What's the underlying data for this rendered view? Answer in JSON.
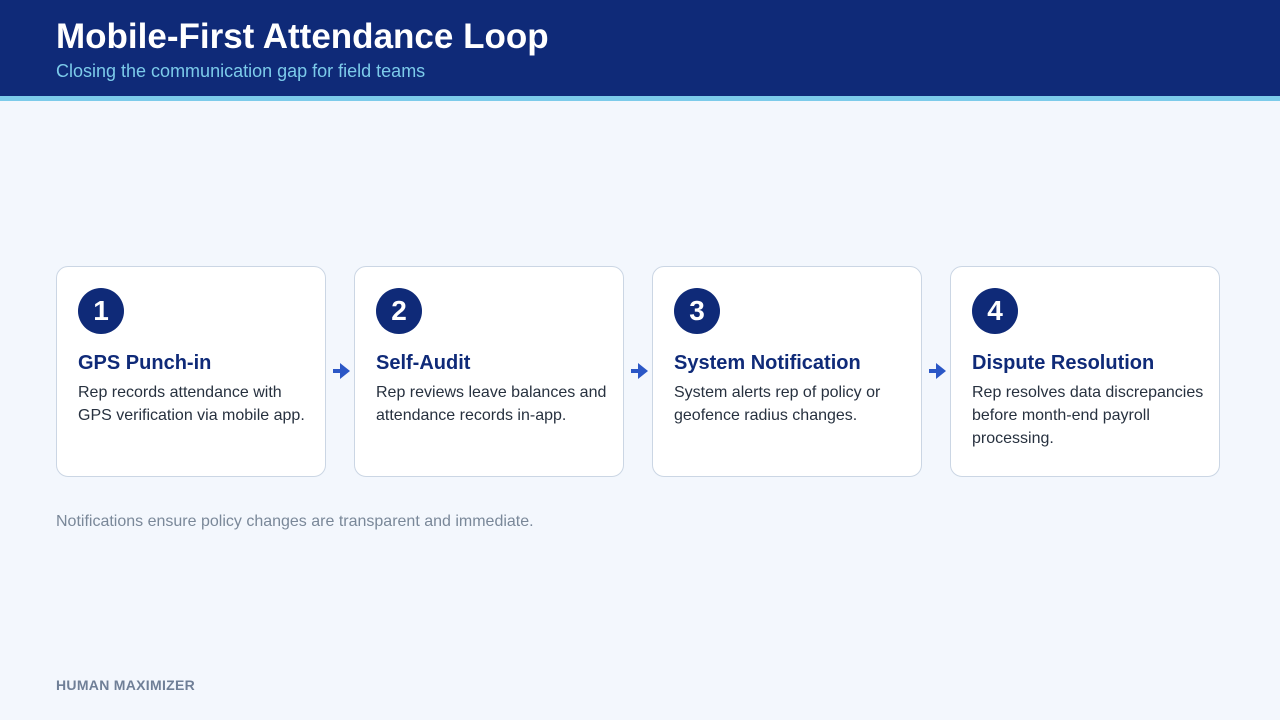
{
  "header": {
    "title": "Mobile-First Attendance Loop",
    "subtitle": "Closing the communication gap for field teams"
  },
  "steps": [
    {
      "number": "1",
      "title": "GPS Punch-in",
      "description": "Rep records attendance with GPS verification via mobile app."
    },
    {
      "number": "2",
      "title": "Self-Audit",
      "description": "Rep reviews leave balances and attendance records in-app."
    },
    {
      "number": "3",
      "title": "System Notification",
      "description": "System alerts rep of policy or geofence radius changes."
    },
    {
      "number": "4",
      "title": "Dispute Resolution",
      "description": "Rep resolves data discrepancies before month-end payroll processing."
    }
  ],
  "footnote": "Notifications ensure policy changes are transparent and immediate.",
  "brand": "HUMAN MAXIMIZER",
  "colors": {
    "primary": "#0f2a78",
    "accent": "#7ccbea",
    "arrow": "#2b57c6",
    "background": "#f3f7fd"
  },
  "icons": {
    "connector": "arrow-right-icon"
  }
}
